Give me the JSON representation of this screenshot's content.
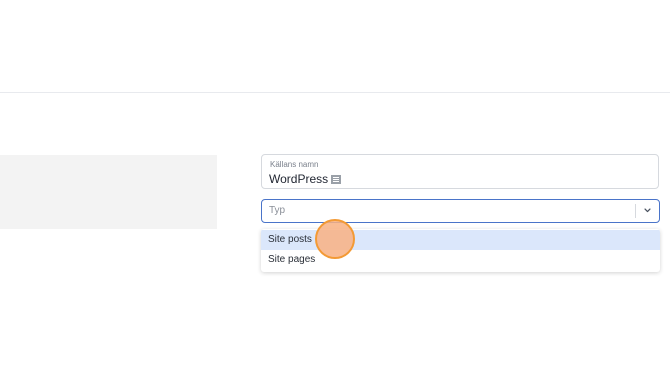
{
  "form": {
    "source_name_label": "Källans namn",
    "source_name_value": "WordPress",
    "source_icon": "newspaper-icon",
    "type_placeholder": "Typ",
    "type_options": [
      "Site posts",
      "Site pages"
    ],
    "highlighted_option": "Site posts"
  },
  "colors": {
    "focus_border": "#4a74c9",
    "highlight_bg": "#dbe7fb",
    "click_marker": "#f39a35"
  }
}
